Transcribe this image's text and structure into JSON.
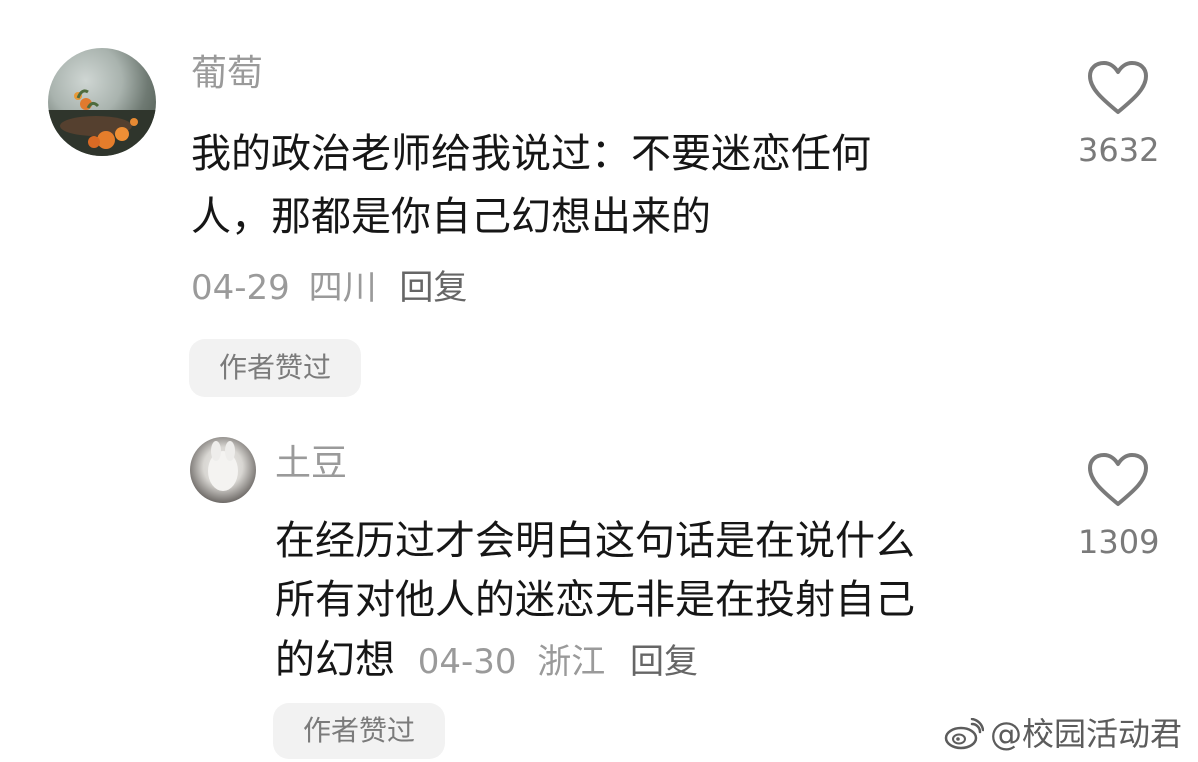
{
  "comment": {
    "username": "葡萄",
    "text_line1": "我的政治老师给我说过：不要迷恋任何",
    "text_line2": "人，那都是你自己幻想出来的",
    "date": "04-29",
    "location": "四川",
    "reply_label": "回复",
    "author_liked_badge": "作者赞过",
    "like_count": "3632"
  },
  "reply": {
    "username": "土豆",
    "text_line1": "在经历过才会明白这句话是在说什么",
    "text_line2": "所有对他人的迷恋无非是在投射自己",
    "text_line3": "的幻想",
    "date": "04-30",
    "location": "浙江",
    "reply_label": "回复",
    "author_liked_badge": "作者赞过",
    "like_count": "1309"
  },
  "watermark": {
    "text": "@校园活动君",
    "icon": "weibo-icon"
  },
  "colors": {
    "text_primary": "#161616",
    "text_secondary": "#9a9a9a",
    "chip_bg": "#f2f2f2",
    "icon": "#7a7a7a"
  }
}
